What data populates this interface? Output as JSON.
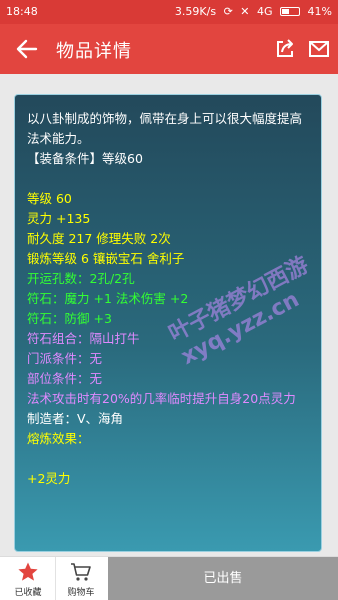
{
  "status_bar": {
    "time": "18:48",
    "speed": "3.59K/s",
    "network": "4G",
    "battery": "41%"
  },
  "appbar": {
    "title": "物品详情"
  },
  "item": {
    "description": "以八卦制成的饰物，佩带在身上可以很大幅度提高法术能力。",
    "equip_condition": "【装备条件】等级60",
    "level": "等级 60",
    "spirit": "灵力 +135",
    "durability": "耐久度 217 修理失败 2次",
    "forging": "锻炼等级 6 镶嵌宝石 舍利子",
    "slots": "开运孔数：2孔/2孔",
    "rune1": "符石：魔力 +1 法术伤害 +2",
    "rune2": "符石：防御 +3",
    "rune_combo": "符石组合：隔山打牛",
    "sect_condition": "门派条件：无",
    "part_condition": "部位条件：无",
    "special_effect": "法术攻击时有20%的几率临时提升自身20点灵力",
    "maker": "制造者：V、海角",
    "melt_label": "熔炼效果：",
    "melt_value": "+2灵力"
  },
  "watermark": {
    "line1": "叶子猪梦幻西游",
    "line2": "xyq.yzz.cn"
  },
  "bottom": {
    "favorite_label": "已收藏",
    "cart_label": "购物车",
    "sold_label": "已出售"
  },
  "colors": {
    "header": "#e2453f",
    "statusbar": "#d93a36",
    "card_top": "#23495b",
    "card_bottom": "#3a9ab0",
    "sold_bg": "#9a9a9a"
  }
}
